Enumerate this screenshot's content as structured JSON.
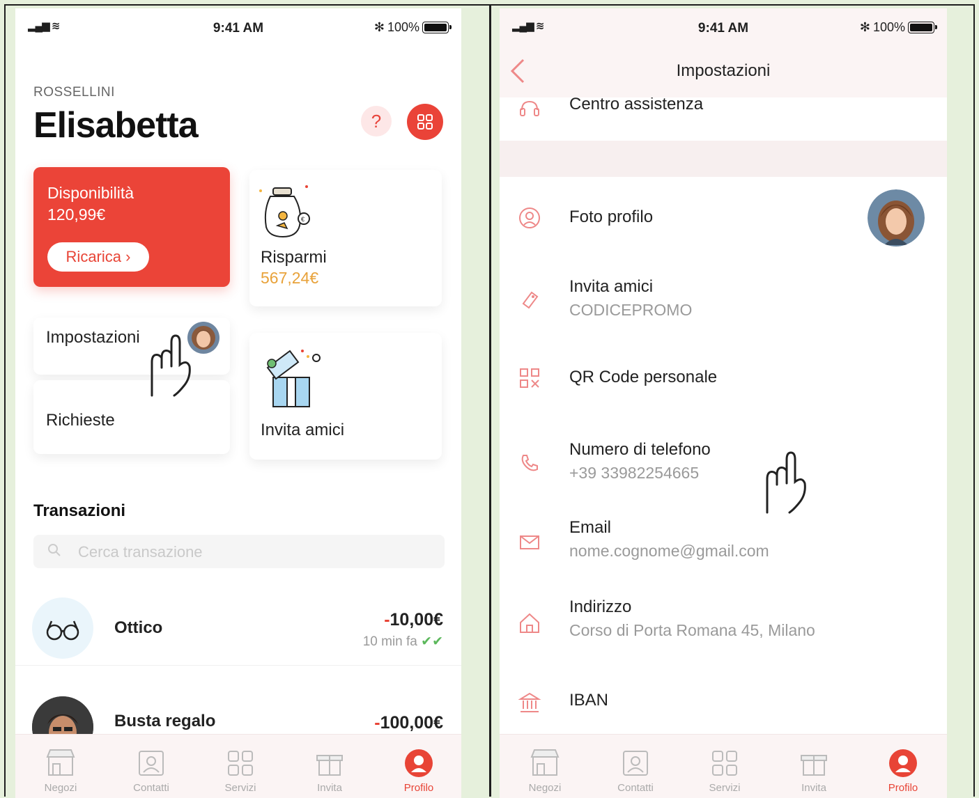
{
  "status_bar": {
    "time": "9:41 AM",
    "battery": "100%"
  },
  "left_screen": {
    "surname": "ROSSELLINI",
    "first_name": "Elisabetta",
    "help_label": "?",
    "balance_card": {
      "label": "Disponibilità",
      "amount": "120,99€",
      "topup_label": "Ricarica ›"
    },
    "savings_card": {
      "label": "Risparmi",
      "amount": "567,24€"
    },
    "settings_card": {
      "label": "Impostazioni"
    },
    "requests_card": {
      "label": "Richieste"
    },
    "invite_card": {
      "label": "Invita amici"
    },
    "transactions": {
      "heading": "Transazioni",
      "search_placeholder": "Cerca transazione",
      "items": [
        {
          "name": "Ottico",
          "amount_sign": "-",
          "amount": "10,00€",
          "time": "10 min fa",
          "icon": "glasses-icon"
        },
        {
          "name": "Busta regalo",
          "amount_sign": "-",
          "amount": "100,00€",
          "icon": "avatar"
        }
      ]
    }
  },
  "right_screen": {
    "title": "Impostazioni",
    "rows": [
      {
        "label": "Centro assistenza",
        "icon": "support-icon"
      },
      {
        "label": "Foto profilo",
        "icon": "profile-icon"
      },
      {
        "label": "Invita amici",
        "value": "CODICEPROMO",
        "icon": "ticket-icon"
      },
      {
        "label": "QR Code personale",
        "icon": "qr-code-icon"
      },
      {
        "label": "Numero di telefono",
        "value": "+39 33982254665",
        "icon": "phone-icon"
      },
      {
        "label": "Email",
        "value": "nome.cognome@gmail.com",
        "icon": "mail-icon"
      },
      {
        "label": "Indirizzo",
        "value": "Corso di Porta Romana 45, Milano",
        "icon": "home-icon"
      },
      {
        "label": "IBAN",
        "icon": "bank-icon"
      }
    ]
  },
  "tabbar": {
    "items": [
      {
        "label": "Negozi",
        "icon": "store-icon"
      },
      {
        "label": "Contatti",
        "icon": "contacts-icon"
      },
      {
        "label": "Servizi",
        "icon": "services-icon"
      },
      {
        "label": "Invita",
        "icon": "gift-icon"
      },
      {
        "label": "Profilo",
        "icon": "profile-icon",
        "active": true
      }
    ]
  },
  "colors": {
    "accent": "#e84436",
    "savings": "#e8a23a",
    "background": "#e6f0dc"
  }
}
